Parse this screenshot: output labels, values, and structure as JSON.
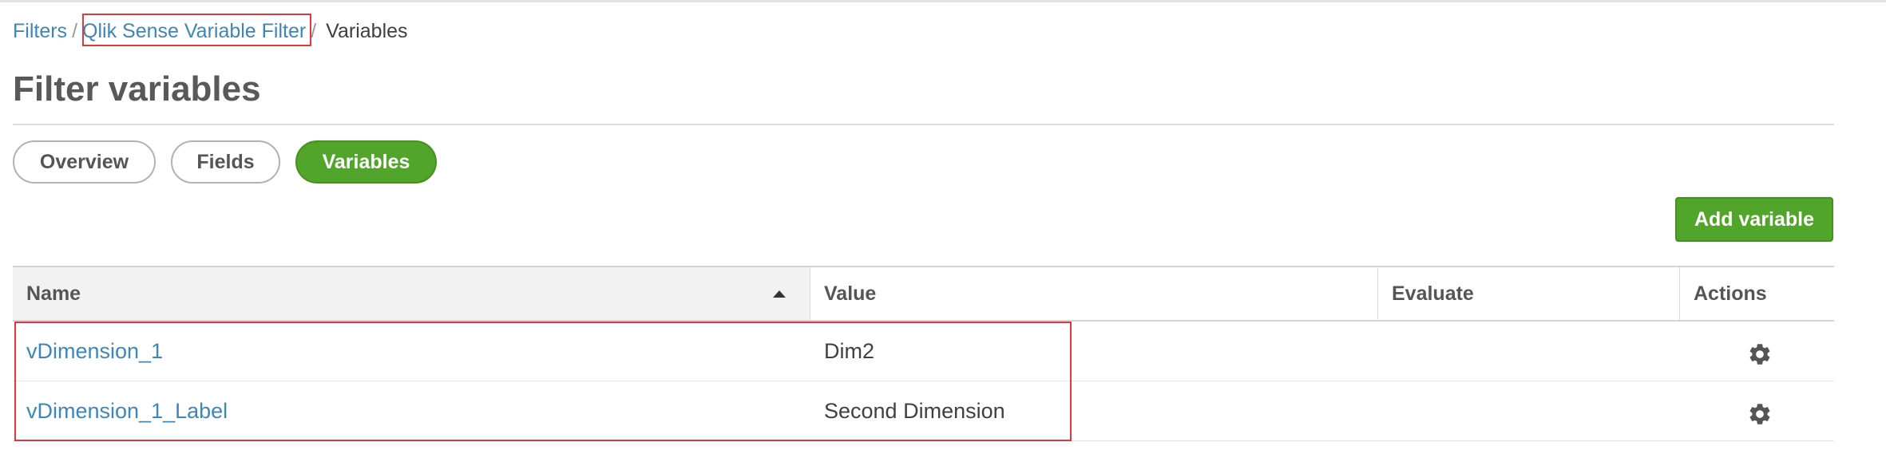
{
  "breadcrumb": {
    "items": [
      {
        "label": "Filters"
      },
      {
        "label": "Qlik Sense Variable Filter"
      }
    ],
    "separator": "/",
    "current": "Variables"
  },
  "page": {
    "title": "Filter variables"
  },
  "tabs": [
    {
      "label": "Overview",
      "active": false
    },
    {
      "label": "Fields",
      "active": false
    },
    {
      "label": "Variables",
      "active": true
    }
  ],
  "toolbar": {
    "add_label": "Add variable"
  },
  "table": {
    "columns": {
      "name": "Name",
      "value": "Value",
      "evaluate": "Evaluate",
      "actions": "Actions"
    },
    "sort": {
      "column": "Name",
      "direction": "ascending"
    },
    "rows": [
      {
        "name": "vDimension_1",
        "value": "Dim2",
        "evaluate": "",
        "action_icon": "gear-icon"
      },
      {
        "name": "vDimension_1_Label",
        "value": "Second Dimension",
        "evaluate": "",
        "action_icon": "gear-icon"
      }
    ]
  },
  "colors": {
    "accent_green": "#52a52b",
    "link_blue": "#3c87b8",
    "highlight_red": "#e0383d"
  }
}
